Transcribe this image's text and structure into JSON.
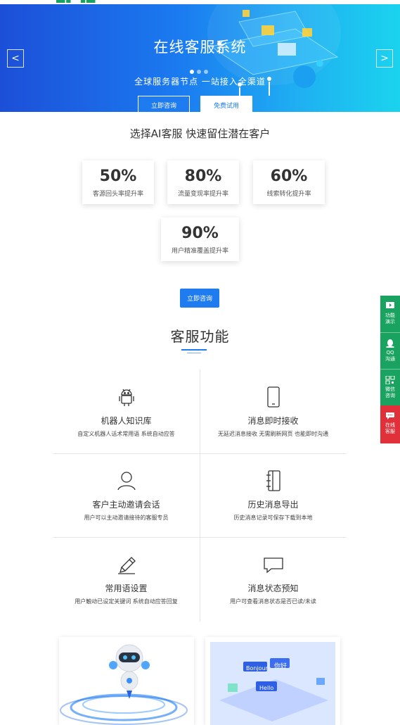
{
  "banner": {
    "title": "在线客服系统",
    "subtitle": "全球服务器节点 一站接入全渠道",
    "primary_btn": "立即咨询",
    "secondary_btn": "免费试用",
    "prev_arrow": "<",
    "next_arrow": ">",
    "colors": {
      "start": "#1c4fd8",
      "end": "#1bd3ee"
    }
  },
  "stats_section": {
    "heading": "选择AI客服 快速留住潜在客户",
    "items": [
      {
        "value": "50%",
        "label": "客源回头率提升率"
      },
      {
        "value": "80%",
        "label": "流量变现率提升率"
      },
      {
        "value": "60%",
        "label": "线索转化提升率"
      },
      {
        "value": "90%",
        "label": "用户精准覆盖提升率"
      }
    ],
    "consult_btn": "立即咨询"
  },
  "features": {
    "title": "客服功能",
    "items": [
      {
        "title": "机器人知识库",
        "desc": "自定义机器人话术常用语 系统自动应答",
        "icon": "android-robot-icon"
      },
      {
        "title": "消息即时接收",
        "desc": "无延迟消息接收 无需刷新网页 也能即时沟通",
        "icon": "mobile-phone-icon"
      },
      {
        "title": "客户主动邀请会话",
        "desc": "用户可以主动邀请接待的客服专员",
        "icon": "user-icon"
      },
      {
        "title": "历史消息导出",
        "desc": "历史消息记录可保存下载到本地",
        "icon": "notebook-icon"
      },
      {
        "title": "常用语设置",
        "desc": "用户触动已设定关键词 系统自动应答回复",
        "icon": "pencil-icon"
      },
      {
        "title": "消息状态预知",
        "desc": "用户可查看消息状态是否已读/未读",
        "icon": "chat-bubble-icon"
      }
    ]
  },
  "cards": {
    "right_bubbles": [
      "你好",
      "Bonjour",
      "Hello"
    ]
  },
  "sidebar": {
    "items": [
      {
        "label1": "功能",
        "label2": "演示",
        "color": "#1aa260",
        "icon": "play-icon"
      },
      {
        "label1": "QQ",
        "label2": "沟通",
        "color": "#1aa260",
        "icon": "qq-icon"
      },
      {
        "label1": "微信",
        "label2": "咨询",
        "color": "#1aa260",
        "icon": "qrcode-icon"
      },
      {
        "label1": "在线",
        "label2": "客服",
        "color": "#e0303a",
        "icon": "message-icon"
      }
    ]
  }
}
